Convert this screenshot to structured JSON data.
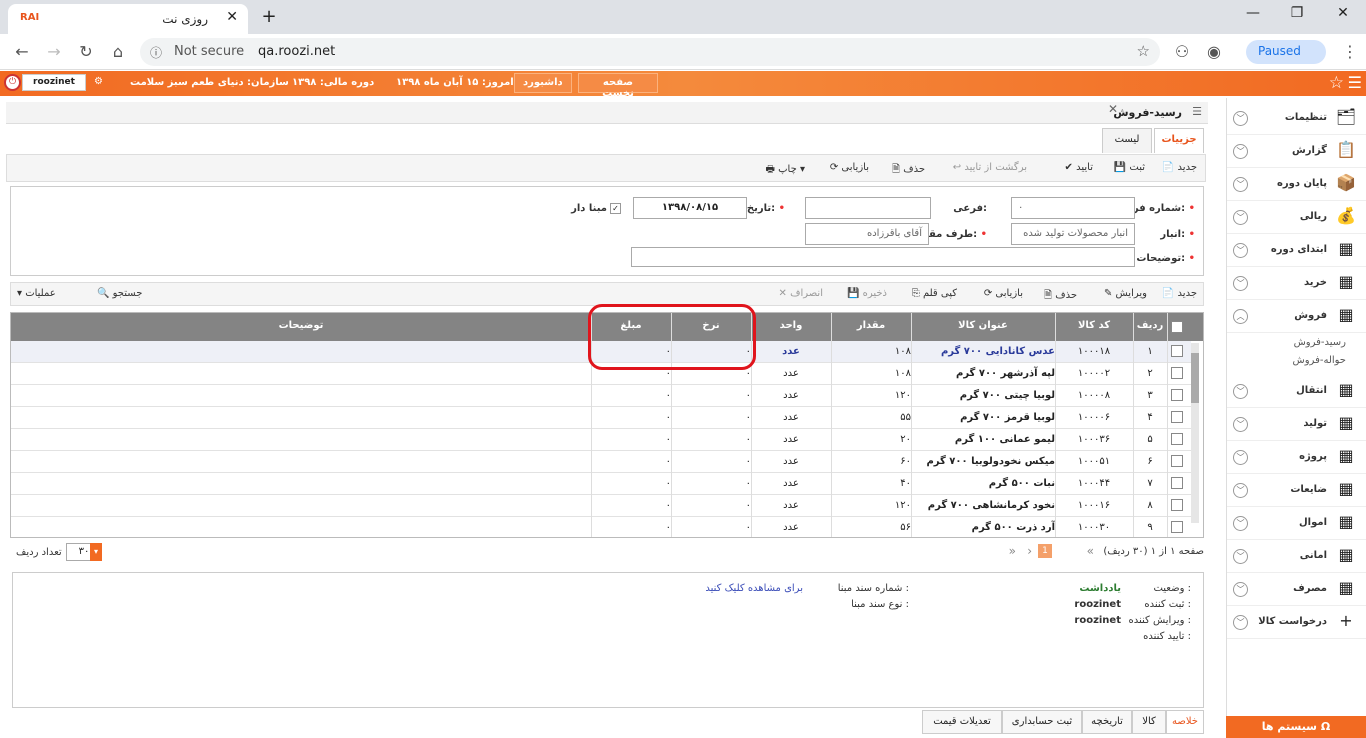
{
  "browser": {
    "tab_title": "روزی نت",
    "favicon": "RAI",
    "url": "qa.roozi.net",
    "security": "Not secure",
    "profile": "Paused"
  },
  "topbar": {
    "user": "roozinet",
    "org": "سازمان: دنیای طعم سبز سلامت",
    "period": "دوره مالی: ۱۳۹۸",
    "today": "امروز: ۱۵ آبان ماه ۱۳۹۸",
    "dashboard": "داشبورد",
    "home": "صفحه نخست"
  },
  "sidebar": {
    "items": [
      {
        "label": "تنظیمات"
      },
      {
        "label": "گزارش"
      },
      {
        "label": "پایان دوره"
      },
      {
        "label": "ریالی"
      },
      {
        "label": "ابتدای دوره"
      },
      {
        "label": "خرید"
      },
      {
        "label": "فروش"
      },
      {
        "label": "انتقال"
      },
      {
        "label": "تولید"
      },
      {
        "label": "پروژه"
      },
      {
        "label": "ضایعات"
      },
      {
        "label": "اموال"
      },
      {
        "label": "امانی"
      },
      {
        "label": "مصرف"
      },
      {
        "label": "درخواست کالا"
      }
    ],
    "subitems": [
      "رسید-فروش",
      "حواله-فروش"
    ],
    "system": "سیستم ها"
  },
  "panel": {
    "title": "رسید-فروش",
    "tabs": [
      "جزییات",
      "لیست"
    ]
  },
  "toolbar1": {
    "new": "جدید",
    "save": "ثبت",
    "approve": "تایید",
    "unapprove": "برگشت از تایید",
    "delete": "حذف",
    "refresh": "بازیابی",
    "print": "چاپ"
  },
  "form": {
    "form_no_label": "شماره فرم:",
    "form_no": "۰",
    "sub_label": "فرعی:",
    "date_label": "تاریخ:",
    "date": "۱۳۹۸/۰۸/۱۵",
    "based_label": "مبنا دار",
    "warehouse_label": "انبار:",
    "warehouse": "انبار محصولات تولید شده",
    "party_label": "طرف مقابل:",
    "party": "آقای باقرزاده",
    "desc_label": "توضیحات:"
  },
  "toolbar2": {
    "new": "جدید",
    "edit": "ویرایش",
    "delete": "حذف",
    "refresh": "بازیابی",
    "copy": "کپی قلم",
    "save": "ذخیره",
    "cancel": "انصراف",
    "search": "جستجو",
    "ops": "عملیات"
  },
  "grid": {
    "headers": {
      "row": "ردیف",
      "code": "کد کالا",
      "title": "عنوان کالا",
      "qty": "مقدار",
      "unit": "واحد",
      "rate": "نرخ",
      "amount": "مبلغ",
      "desc": "توضیحات"
    },
    "rows": [
      {
        "row": "۱",
        "code": "۱۰۰۰۱۸",
        "title": "عدس کانادایی ۷۰۰ گرم",
        "qty": "۱۰۸",
        "unit": "عدد",
        "rate": "۰",
        "amount": "۰"
      },
      {
        "row": "۲",
        "code": "۱۰۰۰۰۲",
        "title": "لپه آذرشهر ۷۰۰ گرم",
        "qty": "۱۰۸",
        "unit": "عدد",
        "rate": "۰",
        "amount": "۰"
      },
      {
        "row": "۳",
        "code": "۱۰۰۰۰۸",
        "title": "لوبیا چیتی ۷۰۰ گرم",
        "qty": "۱۲۰",
        "unit": "عدد",
        "rate": "۰",
        "amount": "۰"
      },
      {
        "row": "۴",
        "code": "۱۰۰۰۰۶",
        "title": "لوبیا قرمز ۷۰۰ گرم",
        "qty": "۵۵",
        "unit": "عدد",
        "rate": "۰",
        "amount": "۰"
      },
      {
        "row": "۵",
        "code": "۱۰۰۰۳۶",
        "title": "لیمو عمانی ۱۰۰ گرم",
        "qty": "۲۰",
        "unit": "عدد",
        "rate": "۰",
        "amount": "۰"
      },
      {
        "row": "۶",
        "code": "۱۰۰۰۵۱",
        "title": "میکس نخودولوبیا ۷۰۰ گرم",
        "qty": "۶۰",
        "unit": "عدد",
        "rate": "۰",
        "amount": "۰"
      },
      {
        "row": "۷",
        "code": "۱۰۰۰۴۴",
        "title": "نبات ۵۰۰ گرم",
        "qty": "۴۰",
        "unit": "عدد",
        "rate": "۰",
        "amount": "۰"
      },
      {
        "row": "۸",
        "code": "۱۰۰۰۱۶",
        "title": "نخود کرمانشاهی ۷۰۰ گرم",
        "qty": "۱۲۰",
        "unit": "عدد",
        "rate": "۰",
        "amount": "۰"
      },
      {
        "row": "۹",
        "code": "۱۰۰۰۳۰",
        "title": "آرد ذرت ۵۰۰ گرم",
        "qty": "۵۶",
        "unit": "عدد",
        "rate": "۰",
        "amount": "۰"
      }
    ]
  },
  "pager": {
    "info": "صفحه ۱ از ۱ (۳۰ ردیف)",
    "page": "1",
    "page_size": "۳۰",
    "page_size_label": "تعداد ردیف"
  },
  "info": {
    "status_label": "وضعیت :",
    "status": "یادداشت",
    "creator_label": "ثبت کننده :",
    "creator": "roozinet",
    "editor_label": "ویرایش کننده :",
    "editor": "roozinet",
    "approver_label": "تایید کننده :",
    "ref_doc_label": "شماره سند مبنا :",
    "ref_doc_link": "برای مشاهده کلیک کنید",
    "ref_type_label": "نوع سند مبنا :"
  },
  "bottom_tabs": [
    "خلاصه",
    "کالا",
    "تاریخچه",
    "ثبت حسابداری",
    "تعدیلات قیمت"
  ]
}
